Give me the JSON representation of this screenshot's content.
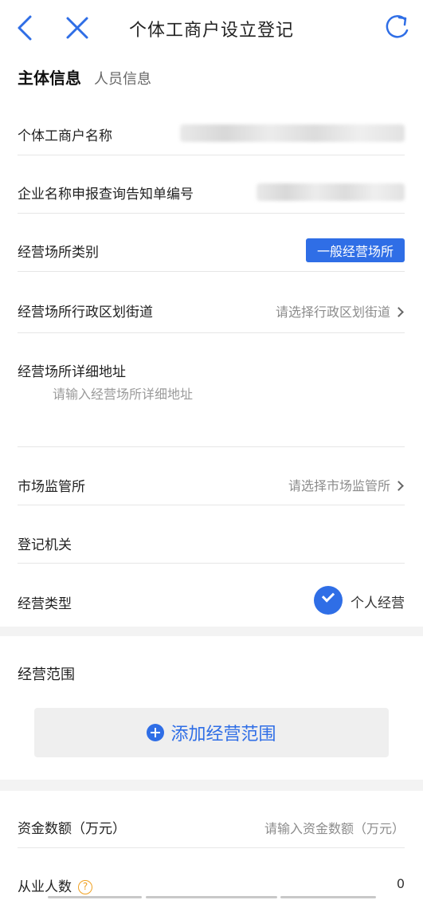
{
  "header": {
    "title": "个体工商户设立登记"
  },
  "tabs": [
    {
      "label": "主体信息"
    },
    {
      "label": "人员信息"
    }
  ],
  "form": {
    "business_name_label": "个体工商户名称",
    "notice_number_label": "企业名称申报查询告知单编号",
    "premises_type_label": "经营场所类别",
    "premises_type_value": "一般经营场所",
    "district_label": "经营场所行政区划街道",
    "district_placeholder": "请选择行政区划街道",
    "address_label": "经营场所详细地址",
    "address_placeholder": "请输入经营场所详细地址",
    "market_supervision_label": "市场监管所",
    "market_supervision_placeholder": "请选择市场监管所",
    "registration_authority_label": "登记机关",
    "operation_type_label": "经营类型",
    "operation_type_value": "个人经营"
  },
  "scope": {
    "title": "经营范围",
    "add_button_label": "添加经营范围"
  },
  "capital": {
    "label": "资金数额（万元）",
    "placeholder": "请输入资金数额（万元）"
  },
  "employees": {
    "label": "从业人数",
    "help_glyph": "?",
    "value": "0"
  },
  "colors": {
    "accent": "#2f6ee6",
    "help": "#f0a020",
    "band": "#f3f3f3"
  }
}
